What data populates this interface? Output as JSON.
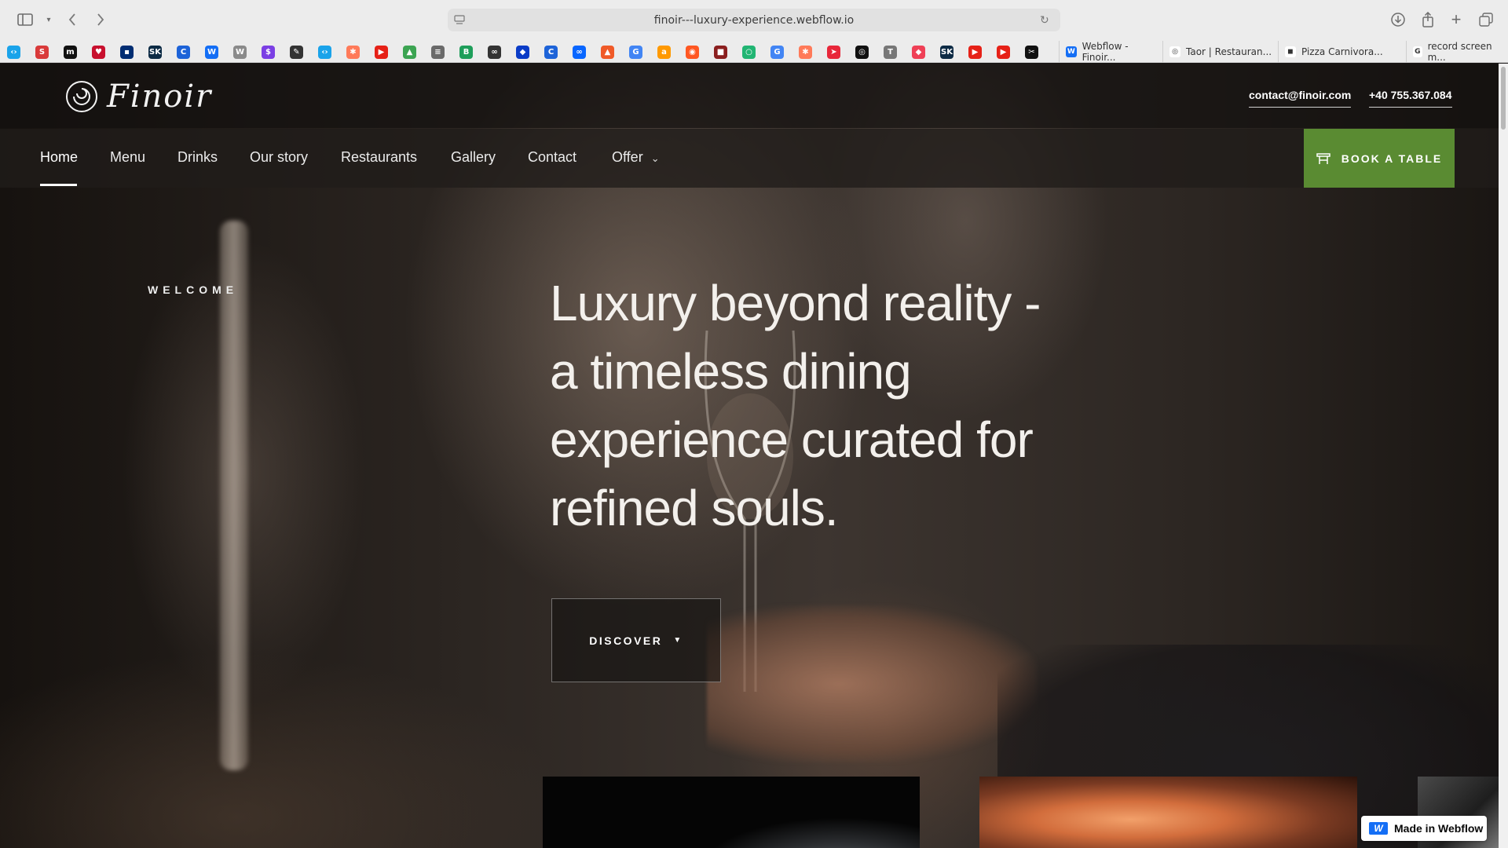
{
  "browser": {
    "url": "finoir---luxury-experience.webflow.io",
    "bookmark_icons": [
      "code-icon",
      "spotify-icon",
      "medium-icon",
      "heart-icon",
      "box-icon",
      "sk-icon",
      "c-icon",
      "webflow-icon",
      "w-icon",
      "dollar-icon",
      "pen-icon",
      "code-icon",
      "hubspot-icon",
      "youtube-icon",
      "triangle-icon",
      "ruler-icon",
      "b-icon",
      "infinity-icon",
      "shield-icon",
      "c-icon",
      "meta-icon",
      "warning-icon",
      "google-icon",
      "amazon-icon",
      "eye-icon",
      "gift-icon",
      "circle-icon",
      "google-icon",
      "hubspot-icon",
      "rocket-icon",
      "openai-icon",
      "t-icon",
      "pocket-icon",
      "sk-icon",
      "youtube-icon",
      "youtube-icon",
      "capcut-icon"
    ],
    "tabs": [
      {
        "label": "Webflow - Finoir..."
      },
      {
        "label": "Taor | Restauran..."
      },
      {
        "label": "Pizza Carnivora..."
      },
      {
        "label": "record screen m..."
      }
    ]
  },
  "site": {
    "logo_text": "Finoir",
    "email": "contact@finoir.com",
    "phone": "+40 755.367.084",
    "nav": [
      {
        "label": "Home"
      },
      {
        "label": "Menu"
      },
      {
        "label": "Drinks"
      },
      {
        "label": "Our story"
      },
      {
        "label": "Restaurants"
      },
      {
        "label": "Gallery"
      },
      {
        "label": "Contact"
      },
      {
        "label": "Offer"
      }
    ],
    "book_label": "BOOK A TABLE",
    "accent_color": "#5a8b32"
  },
  "hero": {
    "eyebrow": "WELCOME",
    "title": "Luxury beyond reality - a timeless dining experience curated for refined souls.",
    "discover_label": "DISCOVER"
  },
  "badge": {
    "label": "Made in Webflow"
  }
}
